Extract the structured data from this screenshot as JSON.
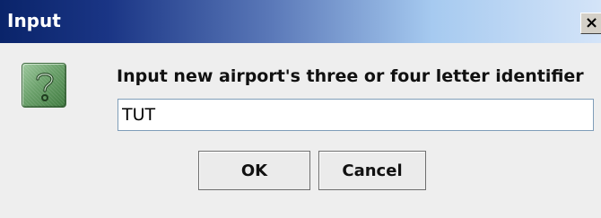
{
  "window": {
    "title": "Input",
    "close_label": "×"
  },
  "dialog": {
    "icon": "question-icon",
    "message": "Input new airport's three or four letter identifier",
    "input_value": "TUT"
  },
  "buttons": {
    "ok_label": "OK",
    "cancel_label": "Cancel"
  },
  "colors": {
    "titlebar_start": "#0a246a",
    "titlebar_end": "#d4e4f8",
    "dialog_bg": "#eeeeee",
    "icon_green": "#6aa06a",
    "input_border": "#7f9db9"
  }
}
